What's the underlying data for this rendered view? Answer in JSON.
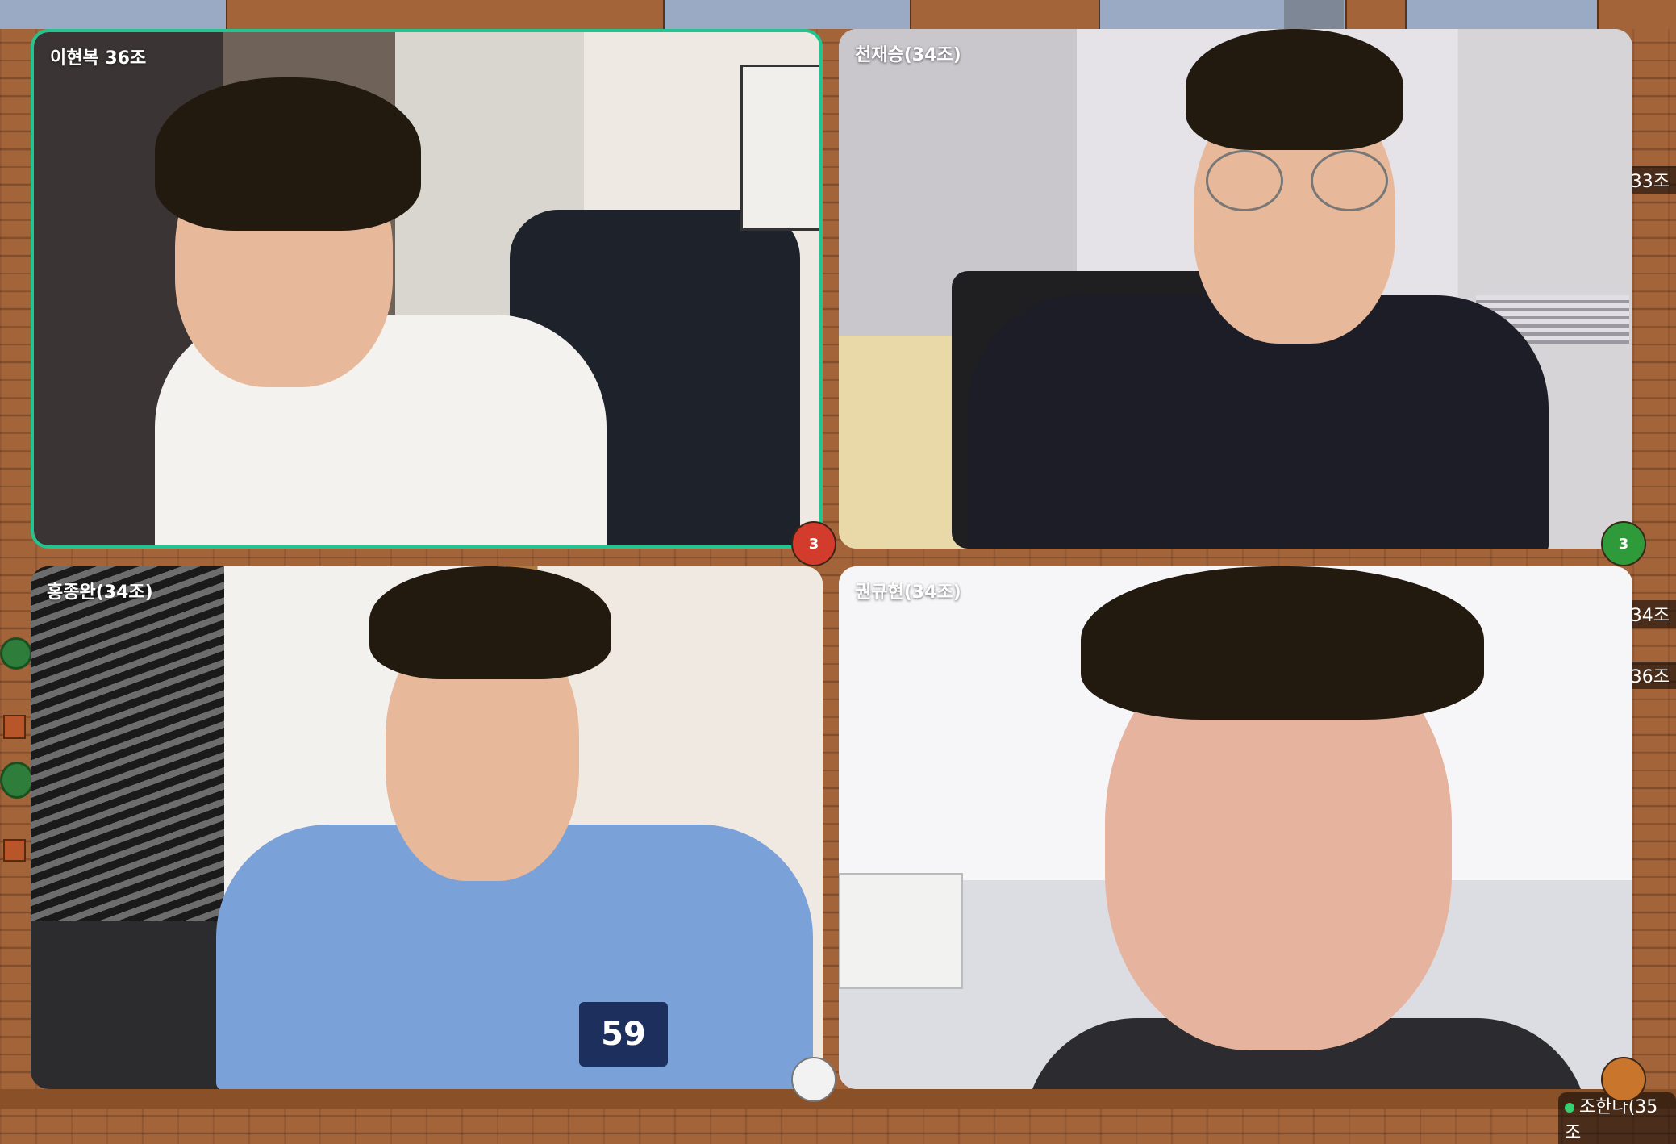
{
  "participants": [
    {
      "name": "이현복 36조",
      "avatar_badge": "3",
      "avatar_color": "#d33b2c",
      "active": true
    },
    {
      "name": "천재승(34조)",
      "avatar_badge": "3",
      "avatar_color": "#2f9a3a",
      "active": false
    },
    {
      "name": "홍종완(34조)",
      "avatar_badge": "",
      "avatar_color": "#ffffff",
      "active": false
    },
    {
      "name": "권규현(34조)",
      "avatar_badge": "",
      "avatar_color": "#c9762c",
      "active": false
    }
  ],
  "map_labels": {
    "right_1": "33조",
    "right_2": "34조",
    "right_3": "36조",
    "bottom_right": "조한나(35조"
  },
  "colors": {
    "active_border": "#23c48f",
    "map_wood": "#a4643a",
    "map_floor": "#9aa9c4"
  }
}
